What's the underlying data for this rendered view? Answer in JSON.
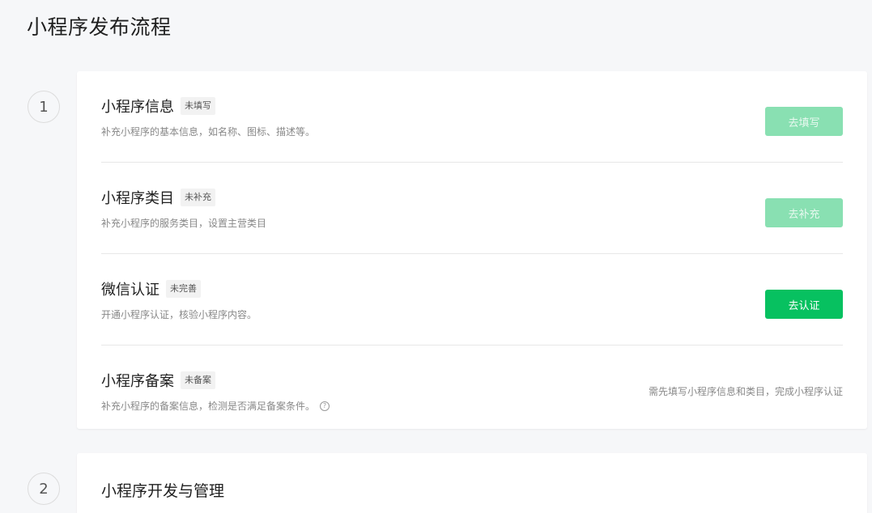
{
  "page": {
    "title": "小程序发布流程"
  },
  "steps": [
    {
      "number": "1",
      "rows": [
        {
          "title": "小程序信息",
          "badge": "未填写",
          "desc": "补充小程序的基本信息，如名称、图标、描述等。",
          "button": "去填写"
        },
        {
          "title": "小程序类目",
          "badge": "未补充",
          "desc": "补充小程序的服务类目，设置主营类目",
          "button": "去补充"
        },
        {
          "title": "微信认证",
          "badge": "未完善",
          "desc": "开通小程序认证，核验小程序内容。",
          "button": "去认证"
        },
        {
          "title": "小程序备案",
          "badge": "未备案",
          "desc": "补充小程序的备案信息，检测是否满足备案条件。",
          "note": "需先填写小程序信息和类目，完成小程序认证",
          "help_icon": "question-circle-icon"
        }
      ]
    },
    {
      "number": "2",
      "title": "小程序开发与管理"
    }
  ],
  "colors": {
    "primary": "#07c160",
    "primary_disabled": "#89e0b2",
    "background": "#f6f7f9"
  }
}
